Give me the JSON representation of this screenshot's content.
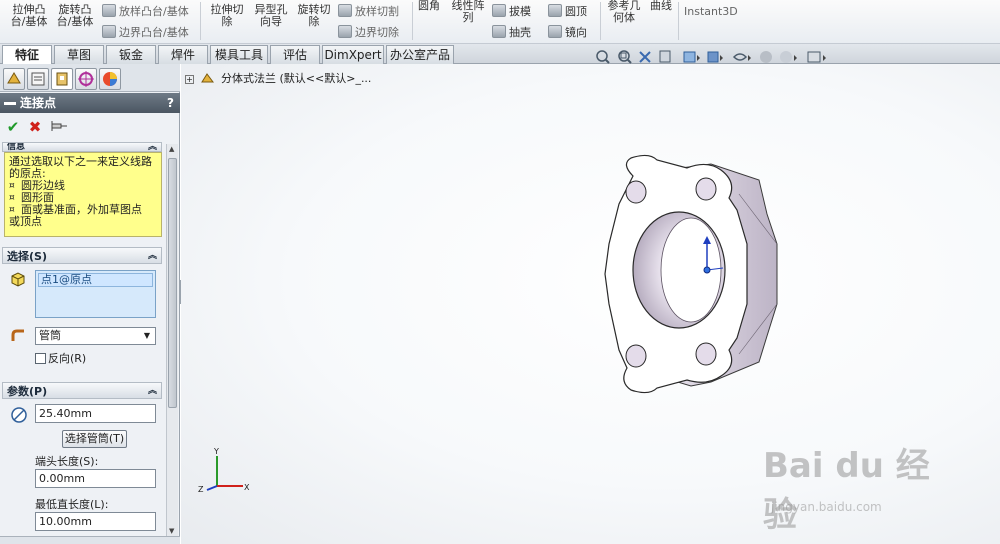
{
  "ribbon": {
    "extrude_boss": "拉伸凸\n台/基体",
    "revolve_boss": "旋转凸\n台/基体",
    "sweep_boss": "放样凸台/基体",
    "boundary_boss": "边界凸台/基体",
    "extrude_cut": "拉伸切\n除",
    "hole_wizard": "异型孔\n向导",
    "revolve_cut": "旋转切\n除",
    "loft_cut": "放样切割",
    "boundary_cut": "边界切除",
    "fillet": "圆角",
    "linear_pattern": "线性阵\n列",
    "draft": "拔模",
    "shell": "抽壳",
    "dome": "圆顶",
    "mirror": "镜向",
    "ref_geometry": "参考几\n何体",
    "curves": "曲线",
    "instant3d": "Instant3D"
  },
  "tabs": [
    {
      "label": "特征",
      "active": true
    },
    {
      "label": "草图",
      "active": false
    },
    {
      "label": "钣金",
      "active": false
    },
    {
      "label": "焊件",
      "active": false
    },
    {
      "label": "模具工具",
      "active": false
    },
    {
      "label": "评估",
      "active": false
    },
    {
      "label": "DimXpert",
      "active": false
    },
    {
      "label": "办公室产品",
      "active": false
    }
  ],
  "panel": {
    "title": "连接点",
    "help": "?",
    "ok_glyph": "✔",
    "cancel_glyph": "✖",
    "message_head": "信息",
    "message_lines": [
      "通过选取以下之一来定义线路",
      "的原点:"
    ],
    "message_items": [
      "圆形边线",
      "圆形面",
      "面或基准面，外加草图点"
    ],
    "message_tail": "或顶点",
    "selection_head": "选择(S)",
    "selection_value": "点1@原点",
    "type_value": "管筒",
    "reverse_label": "反向(R)",
    "params_head": "参数(P)",
    "diameter_value": "25.40mm",
    "select_tube_button": "选择管筒(T)",
    "end_length_label": "端头长度(S):",
    "end_length_value": "0.00mm",
    "min_straight_label": "最低直长度(L):",
    "min_straight_value": "10.00mm"
  },
  "viewport": {
    "tree_label": "分体式法兰  (默认<<默认>_..."
  },
  "triad": {
    "x": "X",
    "y": "Y",
    "z": "Z"
  },
  "watermark": {
    "brand": "Bai du 经验",
    "url": "jingyan.baidu.com"
  },
  "colors": {
    "message_bg": "#ffff8c",
    "title_bg": "#4b5662",
    "part": "#e6e1ec"
  }
}
